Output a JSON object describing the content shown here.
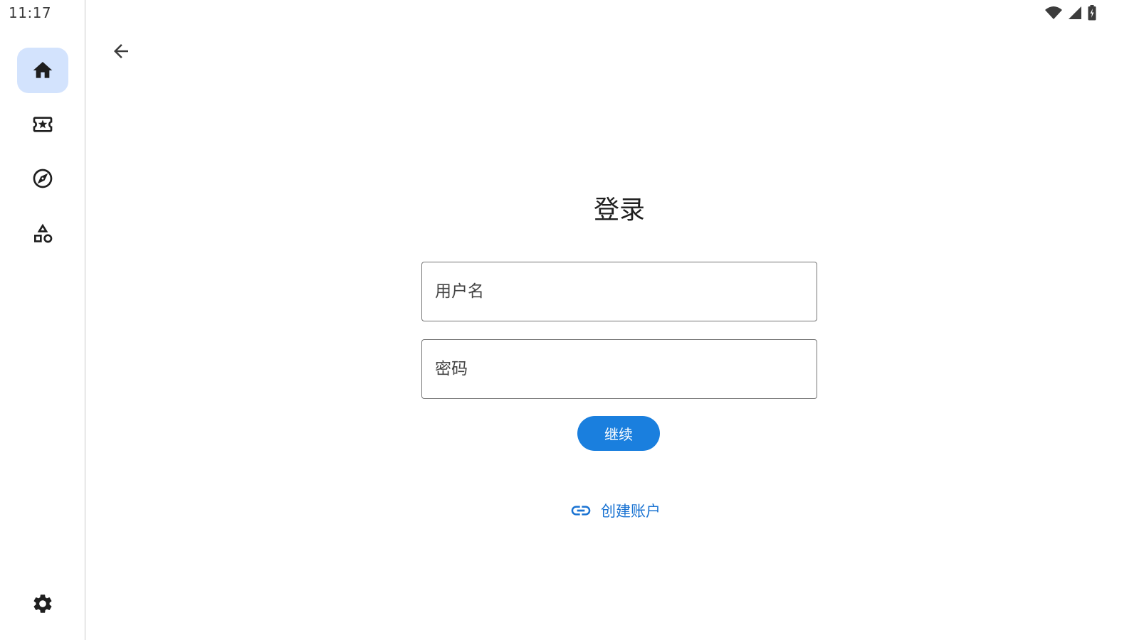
{
  "status_bar": {
    "time": "11:17",
    "icons": [
      "wifi-icon",
      "cellular-signal-icon",
      "battery-charging-icon"
    ]
  },
  "nav_rail": {
    "items": [
      {
        "icon": "home-icon",
        "active": true
      },
      {
        "icon": "ticket-star-icon",
        "active": false
      },
      {
        "icon": "compass-icon",
        "active": false
      },
      {
        "icon": "shapes-icon",
        "active": false
      }
    ],
    "bottom_item": {
      "icon": "settings-gear-icon"
    },
    "active_color": "#d3e3fd"
  },
  "app_bar": {
    "back_icon": "arrow-back-icon"
  },
  "login": {
    "title": "登录",
    "username_placeholder": "用户名",
    "password_placeholder": "密码",
    "continue_label": "继续",
    "create_account_label": "创建账户",
    "create_account_icon": "link-icon"
  },
  "colors": {
    "primary": "#1a7fde",
    "link": "#1a73d2",
    "divider": "#c9c9c9"
  }
}
